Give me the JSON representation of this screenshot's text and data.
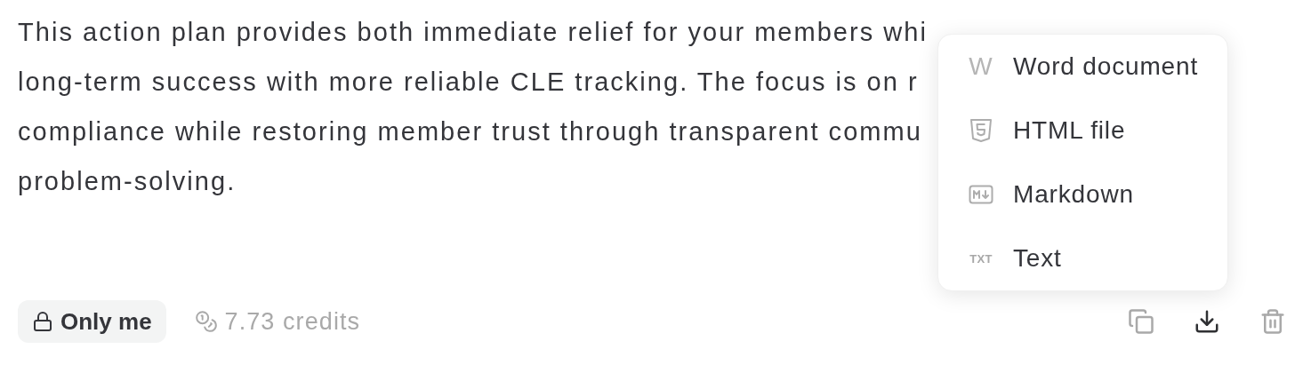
{
  "message": {
    "lines": [
      "This action plan provides both immediate relief for your members whi",
      "long-term success with more reliable CLE tracking. The focus is on r",
      "compliance while restoring member trust through transparent commu",
      "problem-solving."
    ]
  },
  "export_menu": {
    "items": [
      {
        "kind": "word",
        "badge": "W",
        "label": "Word document"
      },
      {
        "kind": "html",
        "label": "HTML file"
      },
      {
        "kind": "markdown",
        "label": "Markdown"
      },
      {
        "kind": "plain",
        "badge": "TXT",
        "label": "Text"
      }
    ]
  },
  "footer": {
    "visibility": "Only me",
    "credits": "7.73 credits",
    "actions": [
      {
        "kind": "copy",
        "expanded": false
      },
      {
        "kind": "download",
        "expanded": true
      },
      {
        "kind": "delete",
        "expanded": false
      }
    ]
  }
}
